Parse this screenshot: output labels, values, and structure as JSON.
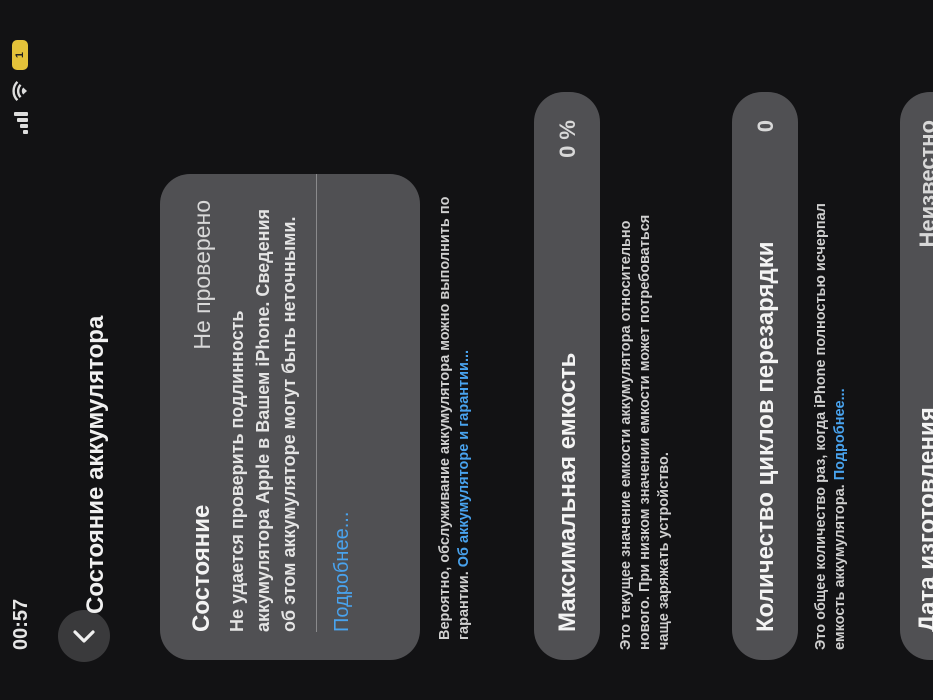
{
  "status": {
    "time": "00:57",
    "battery": "1"
  },
  "nav": {
    "title": "Состояние аккумулятора"
  },
  "state_card": {
    "title": "Состояние",
    "value": "Не проверено",
    "description": "Не удается проверить подлинность аккумулятора Apple в Вашем iPhone. Сведения об этом аккумуляторе могут быть неточными.",
    "more_link": "Подробнее..."
  },
  "service_note": {
    "text": "Вероятно, обслуживание аккумулятора можно выполнить по гарантии.",
    "link": "Об аккумуляторе и гарантии..."
  },
  "max_capacity": {
    "title": "Максимальная емкость",
    "value": "0 %",
    "note": "Это текущее значение емкости аккумулятора относительно нового. При низком значении емкости может потребоваться чаще заряжать устройство."
  },
  "cycle_count": {
    "title": "Количество циклов перезарядки",
    "value": "0",
    "note": "Это общее количество раз, когда iPhone полностью исчерпал емкость аккумулятора.",
    "link": "Подробнее..."
  },
  "manufacture": {
    "title": "Дата изготовления",
    "value": "Неизвестно"
  }
}
